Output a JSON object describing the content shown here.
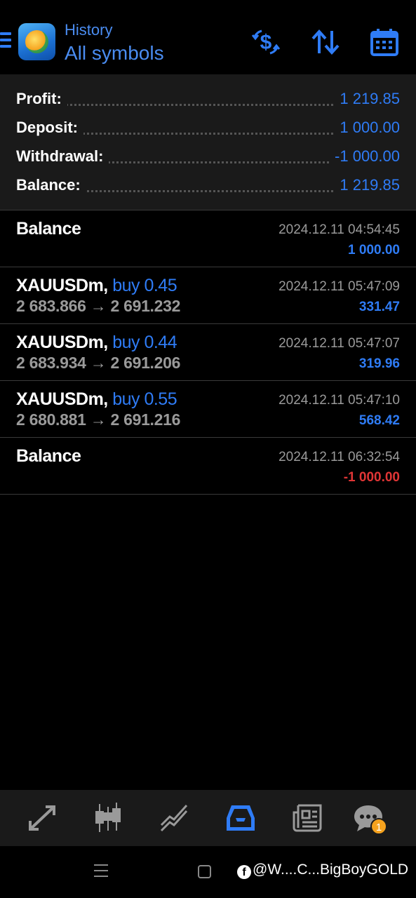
{
  "header": {
    "subtitle": "History",
    "title": "All symbols",
    "icons": [
      "menu-icon",
      "metatrader-logo",
      "deposit-withdraw-icon",
      "sort-icon",
      "calendar-icon"
    ]
  },
  "summary": {
    "rows": [
      {
        "label": "Profit:",
        "value": "1 219.85"
      },
      {
        "label": "Deposit:",
        "value": "1 000.00"
      },
      {
        "label": "Withdrawal:",
        "value": "-1 000.00"
      },
      {
        "label": "Balance:",
        "value": "1 219.85"
      }
    ]
  },
  "entries": [
    {
      "symbol": "Balance",
      "action": "",
      "prices": "",
      "time": "2024.12.11 04:54:45",
      "amount": "1 000.00"
    },
    {
      "symbol": "XAUUSDm,",
      "action": "buy 0.45",
      "prices": "2 683.866 → 2 691.232",
      "time": "2024.12.11 05:47:09",
      "amount": "331.47"
    },
    {
      "symbol": "XAUUSDm,",
      "action": "buy 0.44",
      "prices": "2 683.934 → 2 691.206",
      "time": "2024.12.11 05:47:07",
      "amount": "319.96"
    },
    {
      "symbol": "XAUUSDm,",
      "action": "buy 0.55",
      "prices": "2 680.881 → 2 691.216",
      "time": "2024.12.11 05:47:10",
      "amount": "568.42"
    },
    {
      "symbol": "Balance",
      "action": "",
      "prices": "",
      "time": "2024.12.11 06:32:54",
      "amount": "-1 000.00"
    }
  ],
  "bottom_nav": {
    "items": [
      "quotes-icon",
      "chart-icon",
      "trade-icon",
      "history-icon",
      "news-icon",
      "chat-icon"
    ],
    "active": "history-icon",
    "chat_badge": "1"
  },
  "system_bar": {
    "watermark": "@W....C...BigBoyGOLD"
  },
  "colors": {
    "accent": "#2f7cf6",
    "negative": "#e03535",
    "badge": "#f5a21e"
  }
}
